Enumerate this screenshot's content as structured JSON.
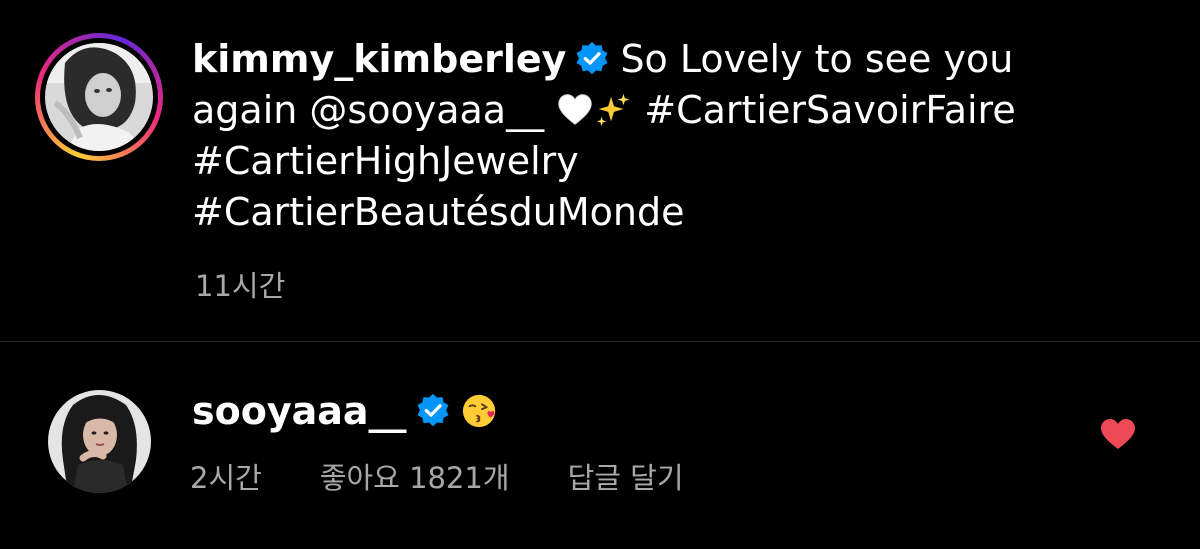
{
  "caption": {
    "username": "kimmy_kimberley",
    "text_line1": "So Lovely to see you",
    "text_line2_prefix": "again ",
    "mention": "@sooyaaa__",
    "hashtag1": "#CartierSavoirFaire",
    "hashtag2": "#CartierHighJewelry",
    "hashtag3": "#CartierBeautésduMonde",
    "emojis": [
      "white-heart-icon",
      "sparkles-icon"
    ],
    "time": "11시간"
  },
  "reply": {
    "username": "sooyaaa__",
    "emoji": "kissing-face-icon",
    "time": "2시간",
    "likes": "좋아요 1821개",
    "reply_label": "답글 달기",
    "liked": true
  },
  "colors": {
    "background": "#000000",
    "text": "#ffffff",
    "muted": "#a8a8a8",
    "verified": "#0095f6",
    "like": "#ed4956",
    "divider": "#262626"
  }
}
